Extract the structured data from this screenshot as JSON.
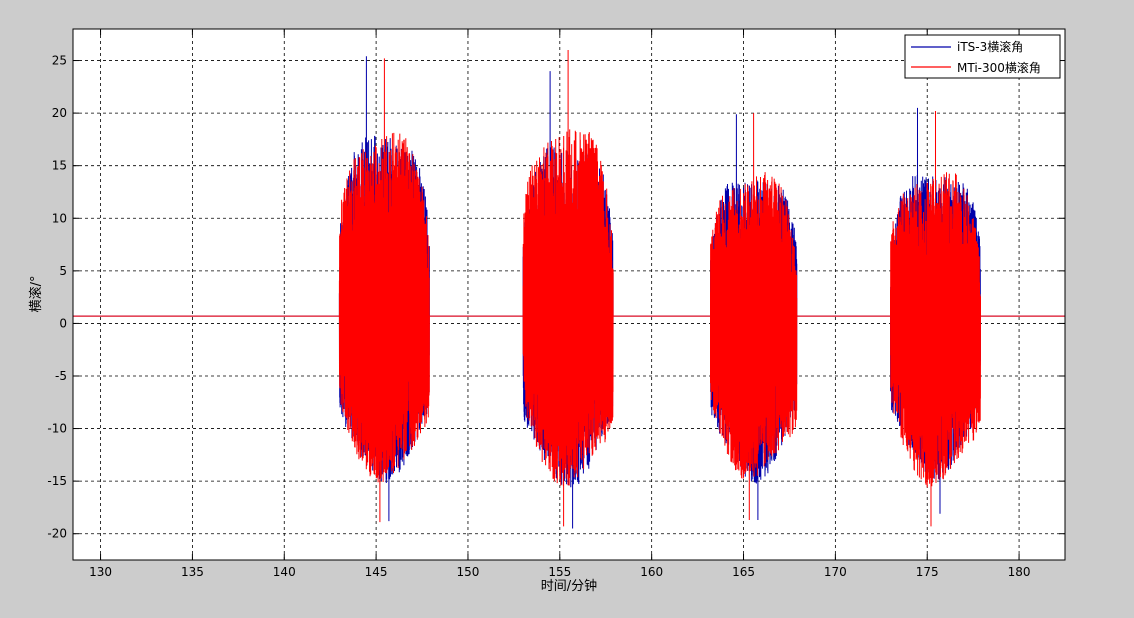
{
  "chart_data": {
    "type": "line",
    "title": "",
    "xlabel": "时间/分钟",
    "ylabel": "横滚/°",
    "xlim": [
      128.5,
      182.5
    ],
    "ylim": [
      -22.5,
      28
    ],
    "xticks": [
      130,
      135,
      140,
      145,
      150,
      155,
      160,
      165,
      170,
      175,
      180
    ],
    "yticks": [
      -20,
      -15,
      -10,
      -5,
      0,
      5,
      10,
      15,
      20,
      25
    ],
    "grid": true,
    "grid_style": "dashed",
    "legend_position": "top-right",
    "baseline_value": 0.7,
    "series": [
      {
        "name": "iTS-3横滚角",
        "color": "#0000aa",
        "active_segments": [
          {
            "start": 143.0,
            "end": 147.9,
            "max": 25.4,
            "min": -18.8
          },
          {
            "start": 153.0,
            "end": 157.9,
            "max": 24.0,
            "min": -19.5
          },
          {
            "start": 163.2,
            "end": 167.9,
            "max": 19.9,
            "min": -18.7
          },
          {
            "start": 173.0,
            "end": 177.9,
            "max": 20.5,
            "min": -18.1
          }
        ]
      },
      {
        "name": "MTi-300横滚角",
        "color": "#ff0000",
        "active_segments": [
          {
            "start": 143.0,
            "end": 147.9,
            "max": 25.2,
            "min": -18.9
          },
          {
            "start": 153.0,
            "end": 157.9,
            "max": 26.0,
            "min": -19.3
          },
          {
            "start": 163.2,
            "end": 167.9,
            "max": 20.0,
            "min": -18.7
          },
          {
            "start": 173.0,
            "end": 177.9,
            "max": 20.2,
            "min": -19.3
          }
        ]
      }
    ]
  }
}
